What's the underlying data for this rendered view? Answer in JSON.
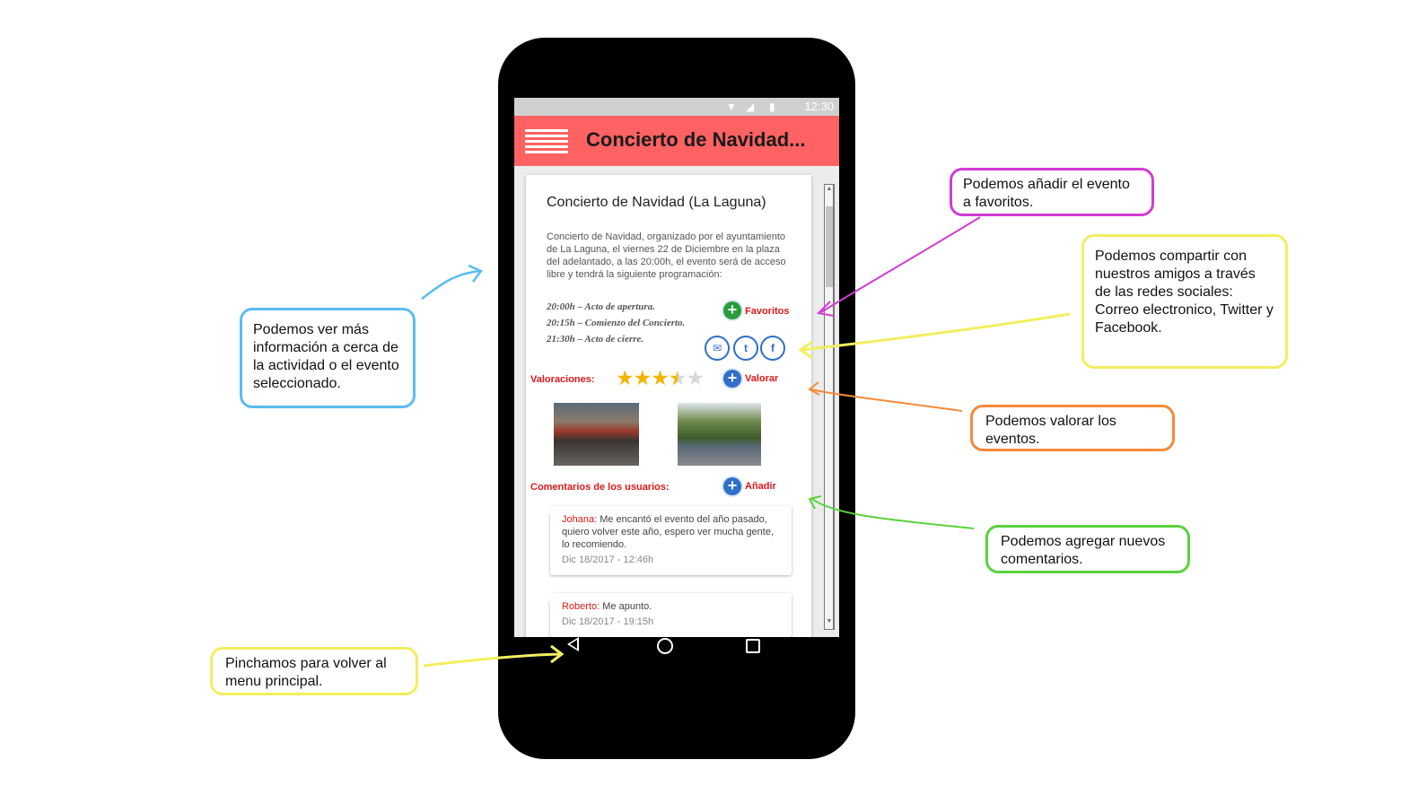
{
  "status_bar": {
    "time": "12:30"
  },
  "app_bar": {
    "title": "Concierto de Navidad...",
    "menu_icon": "hamburger-menu-icon"
  },
  "event": {
    "title": "Concierto de Navidad (La Laguna)",
    "description": "Concierto de Navidad, organizado por el ayuntamiento de La Laguna, el viernes 22 de Diciembre en la plaza del adelantado, a las 20:00h, el evento será de acceso libre y tendrá la siguiente programación:",
    "program": [
      "20:00h – Acto de apertura.",
      "20:15h – Comienzo del Concierto.",
      "21:30h – Acto de cierre."
    ],
    "favorites_label": "Favoritos",
    "share_icons": [
      "email-icon",
      "twitter-icon",
      "facebook-icon"
    ],
    "ratings_label": "Valoraciones:",
    "rating_value": 3.5,
    "rating_max": 5,
    "rate_label": "Valorar",
    "comments_label": "Comentarios de los usuarios:",
    "add_label": "Añadir",
    "comments": [
      {
        "author": "Johana:",
        "text": " Me encantó el evento del año pasado, quiero volver este año, espero ver mucha gente, lo recomiendo.",
        "date": "Dic 18/2017 - 12:46h"
      },
      {
        "author": "Roberto:",
        "text": " Me apunto.",
        "date": "Dic 18/2017 - 19:15h"
      }
    ]
  },
  "nav_bar": {
    "back_icon": "back-triangle-icon",
    "home_icon": "home-circle-icon",
    "recent_icon": "recent-square-icon"
  },
  "callouts": {
    "info": "Podemos ver más información a cerca de la actividad o el evento seleccionado.",
    "favorites": "Podemos añadir el evento a favoritos.",
    "share": "Podemos compartir con nuestros amigos a través de las redes sociales: Correo electronico, Twitter y Facebook.",
    "rate": "Podemos valorar los eventos.",
    "comments": "Podemos agregar nuevos comentarios.",
    "back": "Pinchamos para volver al menu principal."
  },
  "colors": {
    "app_bar": "#fe6262",
    "accent_red": "#e01818",
    "favorites_green": "#2a9d3a",
    "action_blue": "#2f6fc7",
    "callout_blue": "#5bbcf0",
    "callout_magenta": "#d23bd2",
    "callout_yellow": "#f3ee5f",
    "callout_orange": "#f58a3a",
    "callout_green": "#5ad23c"
  }
}
